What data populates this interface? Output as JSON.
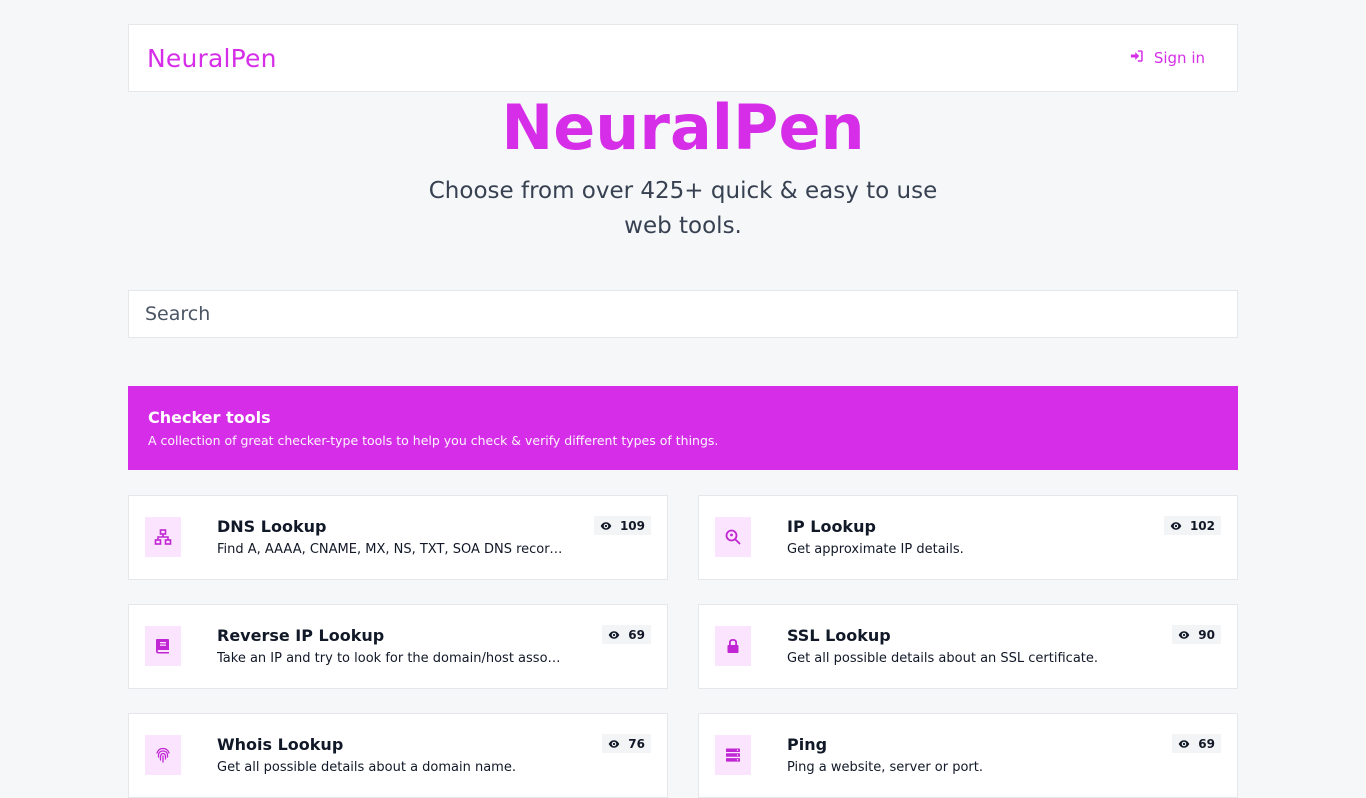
{
  "header": {
    "brand": "NeuralPen",
    "signin_label": "Sign in"
  },
  "hero": {
    "title": "NeuralPen",
    "subtitle": "Choose from over 425+ quick & easy to use web tools."
  },
  "search": {
    "placeholder": "Search"
  },
  "category": {
    "title": "Checker tools",
    "description": "A collection of great checker-type tools to help you check & verify different types of things."
  },
  "tools": [
    {
      "name": "DNS Lookup",
      "description": "Find A, AAAA, CNAME, MX, NS, TXT, SOA DNS records of a host.",
      "views": "109",
      "icon": "sitemap-icon"
    },
    {
      "name": "IP Lookup",
      "description": "Get approximate IP details.",
      "views": "102",
      "icon": "search-location-icon"
    },
    {
      "name": "Reverse IP Lookup",
      "description": "Take an IP and try to look for the domain/host associated with it.",
      "views": "69",
      "icon": "book-icon"
    },
    {
      "name": "SSL Lookup",
      "description": "Get all possible details about an SSL certificate.",
      "views": "90",
      "icon": "lock-icon"
    },
    {
      "name": "Whois Lookup",
      "description": "Get all possible details about a domain name.",
      "views": "76",
      "icon": "fingerprint-icon"
    },
    {
      "name": "Ping",
      "description": "Ping a website, server or port.",
      "views": "69",
      "icon": "server-icon"
    }
  ],
  "colors": {
    "accent": "#d62ee8",
    "icon_bg": "#fbe4fd",
    "page_bg": "#f6f7f9"
  }
}
